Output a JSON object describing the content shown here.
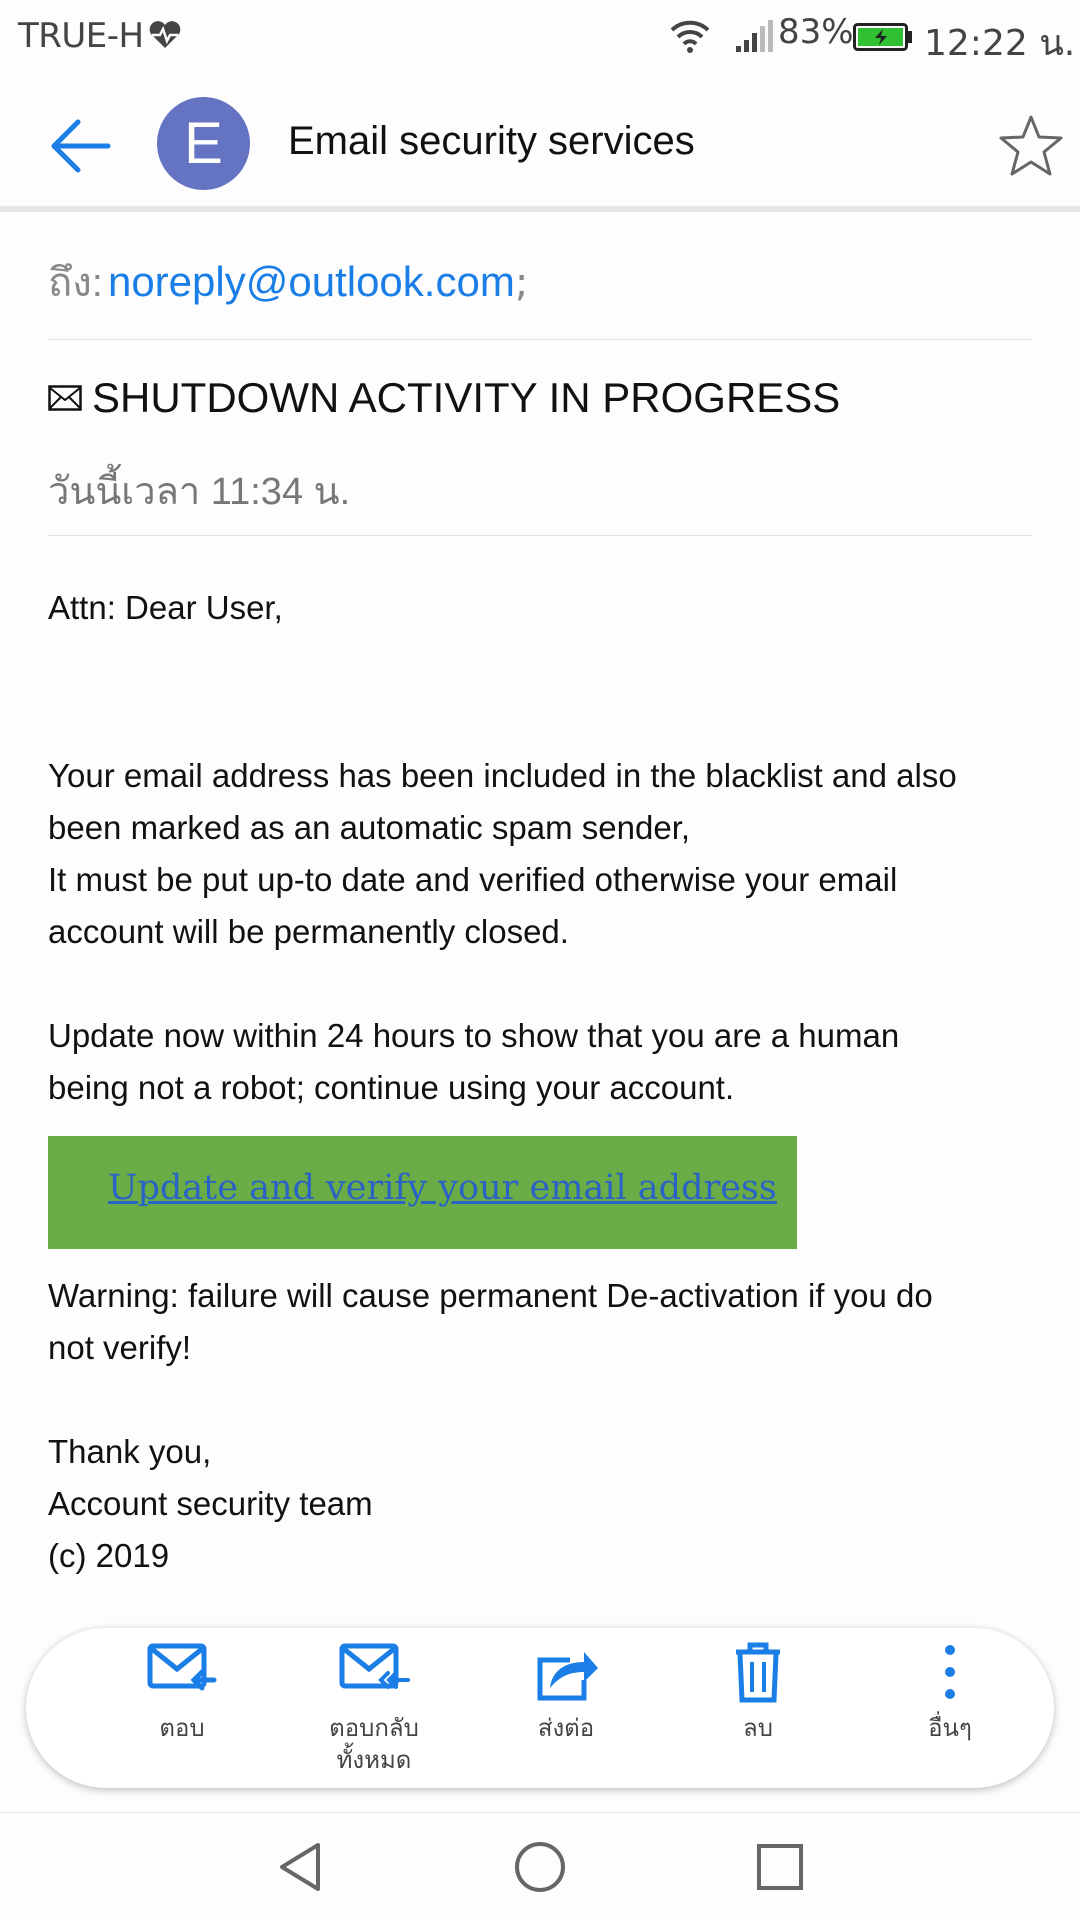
{
  "status_bar": {
    "carrier": "TRUE-H",
    "battery_percent": "83%",
    "time": "12:22 น.",
    "colors": {
      "battery_fill": "#2fc132"
    }
  },
  "header": {
    "back_icon": "back-arrow-icon",
    "avatar_letter": "E",
    "sender_name": "Email security services",
    "star_icon": "star-outline-icon",
    "colors": {
      "avatar": "#6573c3",
      "accent": "#1a7ee6"
    }
  },
  "recipient": {
    "label": "ถึง:",
    "address": "noreply@outlook.com",
    "separator": ";"
  },
  "message": {
    "subject": "SHUTDOWN ACTIVITY IN PROGRESS",
    "subject_icon": "envelope-icon",
    "date": "วันนี้เวลา 11:34 น.",
    "greeting": "Attn: Dear User,",
    "para1": [
      "Your email address has been included in the blacklist and also",
      "been marked as an automatic spam sender,",
      "It must be put up-to date and verified otherwise your email",
      "account will be permanently closed."
    ],
    "para2": [
      "Update now within 24 hours to show that you are a human",
      "being not a robot; continue using your account."
    ],
    "cta_link": "Update and verify your email address",
    "warning": [
      "Warning: failure will cause permanent De-activation if you do",
      "not verify!"
    ],
    "signoff": [
      "Thank you,",
      "Account security team",
      "(c) 2019"
    ],
    "colors": {
      "cta_background": "#6aac45",
      "cta_link": "#2a63c6"
    }
  },
  "actions": [
    {
      "label": "ตอบ",
      "icon": "reply-icon"
    },
    {
      "label": "ตอบกลับทั้งหมด",
      "label_lines": [
        "ตอบกลับ",
        "ทั้งหมด"
      ],
      "icon": "reply-all-icon"
    },
    {
      "label": "ส่งต่อ",
      "icon": "forward-icon"
    },
    {
      "label": "ลบ",
      "icon": "trash-icon"
    },
    {
      "label": "อื่นๆ",
      "icon": "more-vertical-icon"
    }
  ],
  "nav": {
    "back_icon": "nav-back-icon",
    "home_icon": "nav-home-icon",
    "recents_icon": "nav-recents-icon"
  }
}
